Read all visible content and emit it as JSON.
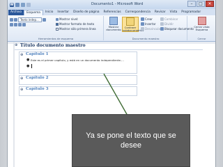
{
  "window": {
    "title": "Documento1 - Microsoft Word",
    "app_icon": "W",
    "controls": [
      "–",
      "□",
      "✕"
    ]
  },
  "tabs": [
    {
      "label": "Archivo",
      "active": false,
      "file": true
    },
    {
      "label": "Esquema",
      "active": true,
      "file": false
    },
    {
      "label": "Inicio",
      "active": false,
      "file": false
    },
    {
      "label": "Insertar",
      "active": false,
      "file": false
    },
    {
      "label": "Diseño de página",
      "active": false,
      "file": false
    },
    {
      "label": "Referencias",
      "active": false,
      "file": false
    },
    {
      "label": "Correspondencia",
      "active": false,
      "file": false
    },
    {
      "label": "Revisar",
      "active": false,
      "file": false
    },
    {
      "label": "Vista",
      "active": false,
      "file": false
    },
    {
      "label": "Programador",
      "active": false,
      "file": false
    }
  ],
  "ribbon": {
    "outline_tools": {
      "level_select": "Texto indep...",
      "show_level_label": "Mostrar nivel:",
      "show_text_format": "Mostrar formato de texto",
      "show_first_line": "Mostrar sólo primera línea",
      "group_label": "Herramientas de esquema"
    },
    "master_doc": {
      "show_doc_label": "Mostrar documento",
      "collapse_label": "Contraer subdocumentos",
      "create": "Crear",
      "insert": "Insertar",
      "unlink": "Desvincular",
      "combine": "Combinar",
      "split": "Dividir",
      "lock": "Bloquear documento",
      "group_label": "Documento maestro"
    },
    "close": {
      "label": "Cerrar vista Esquema",
      "group_label": "Cerrar"
    }
  },
  "document": {
    "title": "Título documento maestro",
    "chapters": [
      {
        "heading": "Capítulo 1",
        "body": "Este es el primer capítulo, y está en un documento independiente...."
      },
      {
        "heading": "Capítulo 2",
        "body": ""
      },
      {
        "heading": "Capítulo 3",
        "body": ""
      }
    ]
  },
  "callout": {
    "text": "Ya se pone el texto que se desee"
  },
  "colors": {
    "file_tab": "#2a579a",
    "heading": "#4f81bd",
    "title": "#1f3b66",
    "callout_bg": "#5a5a5a"
  }
}
